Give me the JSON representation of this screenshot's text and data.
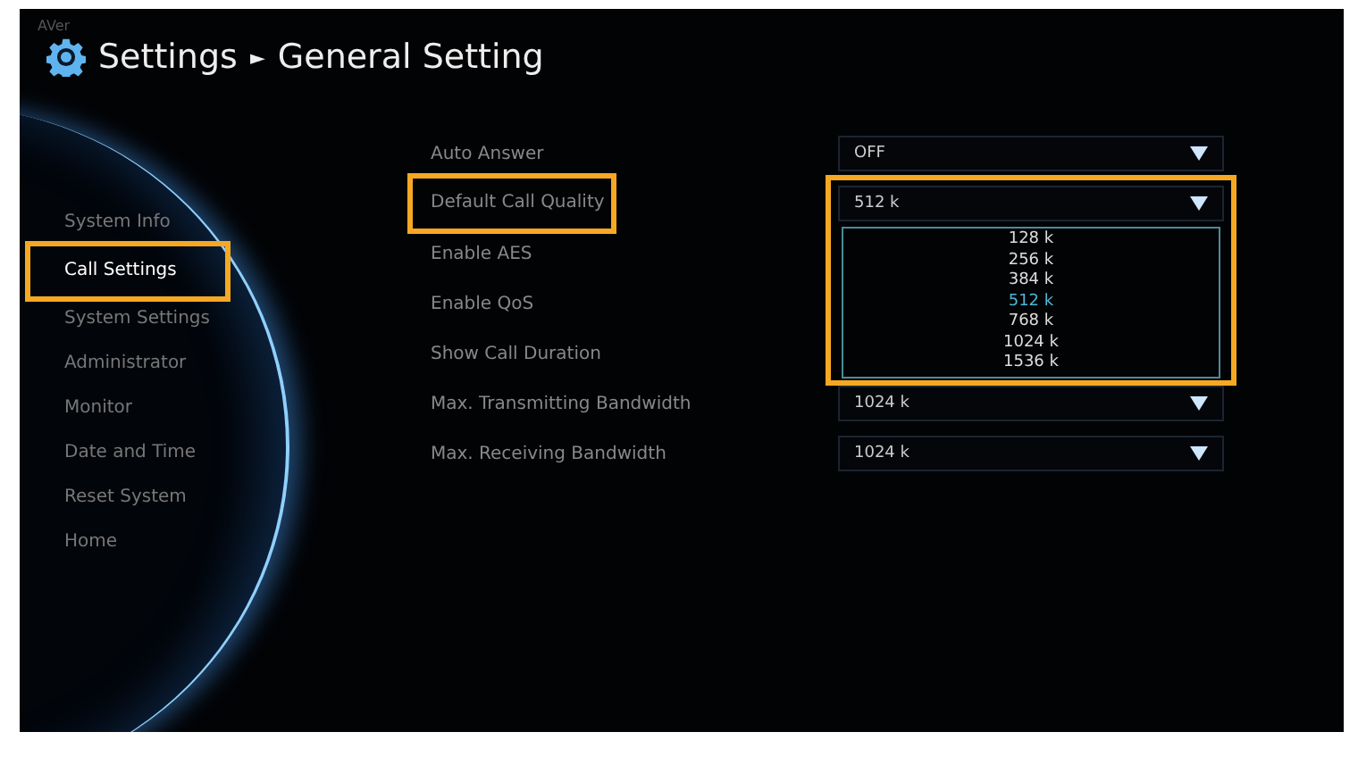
{
  "logo": "AVer",
  "title": {
    "section": "Settings",
    "separator": "►",
    "page": "General Setting"
  },
  "sidebar": {
    "items": [
      {
        "label": "System Info",
        "selected": false,
        "highlighted": false
      },
      {
        "label": "Call Settings",
        "selected": true,
        "highlighted": true
      },
      {
        "label": "System Settings",
        "selected": false,
        "highlighted": false
      },
      {
        "label": "Administrator",
        "selected": false,
        "highlighted": false
      },
      {
        "label": "Monitor",
        "selected": false,
        "highlighted": false
      },
      {
        "label": "Date and Time",
        "selected": false,
        "highlighted": false
      },
      {
        "label": "Reset System",
        "selected": false,
        "highlighted": false
      },
      {
        "label": "Home",
        "selected": false,
        "highlighted": false
      }
    ]
  },
  "settings": [
    {
      "label": "Auto Answer",
      "highlighted": false,
      "value": "OFF"
    },
    {
      "label": "Default Call Quality",
      "highlighted": true,
      "value": "512 k",
      "options": [
        {
          "label": "128 k",
          "selected": false
        },
        {
          "label": "256 k",
          "selected": false
        },
        {
          "label": "384 k",
          "selected": false
        },
        {
          "label": "512 k",
          "selected": true
        },
        {
          "label": "768 k",
          "selected": false
        },
        {
          "label": "1024 k",
          "selected": false
        },
        {
          "label": "1536 k",
          "selected": false
        }
      ]
    },
    {
      "label": "Enable AES",
      "highlighted": false
    },
    {
      "label": "Enable QoS",
      "highlighted": false
    },
    {
      "label": "Show Call Duration",
      "highlighted": false
    },
    {
      "label": "Max. Transmitting Bandwidth",
      "highlighted": false,
      "value": "1024 k"
    },
    {
      "label": "Max. Receiving Bandwidth",
      "highlighted": false,
      "value": "1024 k"
    }
  ]
}
